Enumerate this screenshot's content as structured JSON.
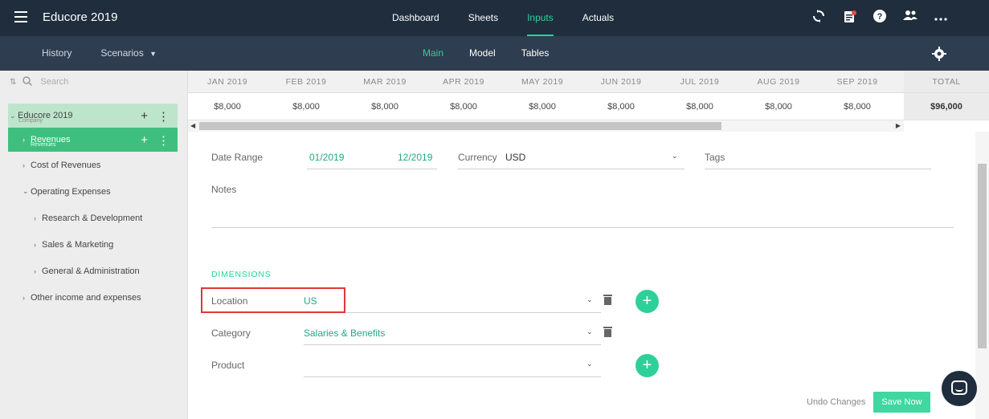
{
  "app": {
    "title": "Educore 2019",
    "nav": [
      {
        "label": "Dashboard",
        "active": false
      },
      {
        "label": "Sheets",
        "active": false
      },
      {
        "label": "Inputs",
        "active": true
      },
      {
        "label": "Actuals",
        "active": false
      }
    ],
    "icons": [
      "sync-icon",
      "notes-icon",
      "help-icon",
      "users-icon",
      "more-icon"
    ]
  },
  "subnav": {
    "history": "History",
    "scenarios": "Scenarios",
    "tabs": [
      {
        "label": "Main",
        "active": true
      },
      {
        "label": "Model",
        "active": false
      },
      {
        "label": "Tables",
        "active": false
      }
    ]
  },
  "sidebar": {
    "search_placeholder": "Search",
    "company": {
      "label": "Educore 2019",
      "sub": "Company"
    },
    "selected": {
      "label": "Revenues",
      "sub": "Revenues"
    },
    "items": [
      {
        "label": "Cost of Revenues",
        "expanded": false
      },
      {
        "label": "Operating Expenses",
        "expanded": true
      },
      {
        "label": "Research & Development",
        "expanded": false
      },
      {
        "label": "Sales & Marketing",
        "expanded": false
      },
      {
        "label": "General & Administration",
        "expanded": false
      },
      {
        "label": "Other income and expenses",
        "expanded": false
      }
    ]
  },
  "grid": {
    "months": [
      "JAN 2019",
      "FEB 2019",
      "MAR 2019",
      "APR 2019",
      "MAY 2019",
      "JUN 2019",
      "JUL 2019",
      "AUG 2019",
      "SEP 2019"
    ],
    "values": [
      "$8,000",
      "$8,000",
      "$8,000",
      "$8,000",
      "$8,000",
      "$8,000",
      "$8,000",
      "$8,000",
      "$8,000"
    ],
    "total_label": "TOTAL",
    "total_value": "$96,000"
  },
  "form": {
    "date_range_label": "Date Range",
    "date_from": "01/2019",
    "date_to": "12/2019",
    "currency_label": "Currency",
    "currency_value": "USD",
    "tags_label": "Tags",
    "notes_label": "Notes",
    "dimensions_title": "DIMENSIONS",
    "dimensions": [
      {
        "label": "Location",
        "value": "US"
      },
      {
        "label": "Category",
        "value": "Salaries & Benefits"
      },
      {
        "label": "Product",
        "value": ""
      }
    ]
  },
  "footer": {
    "undo": "Undo Changes",
    "save": "Save Now"
  },
  "colors": {
    "accent": "#2ed09a",
    "topbar": "#1f2d3d",
    "subbar": "#2e3d4f",
    "highlight": "#e0363a"
  }
}
